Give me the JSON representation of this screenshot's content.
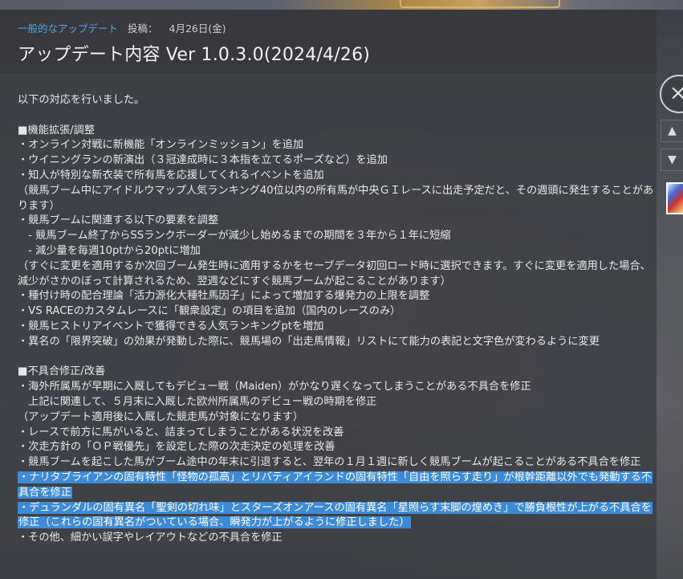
{
  "header": {
    "category": "一般的なアップデート",
    "posted_label": "投稿：",
    "date": "4月26日(金)",
    "title": "アップデート内容 Ver 1.0.3.0(2024/4/26)"
  },
  "body": {
    "intro": "以下の対応を行いました。",
    "section1": {
      "heading": "■機能拡張/調整",
      "lines": [
        "・オンライン対戦に新機能「オンラインミッション」を追加",
        "・ウイニングランの新演出（３冠達成時に３本指を立てるポーズなど）を追加",
        "・知人が特別な新衣装で所有馬を応援してくれるイベントを追加",
        "（競馬ブーム中にアイドルウマップ人気ランキング40位以内の所有馬が中央ＧＩレースに出走予定だと、その週頭に発生することがあります）",
        "・競馬ブームに関連する以下の要素を調整",
        "　- 競馬ブーム終了からSSランクボーダーが減少し始めるまでの期間を３年から１年に短縮",
        "　- 減少量を毎週10ptから20ptに増加",
        "（すぐに変更を適用するか次回ブーム発生時に適用するかをセーブデータ初回ロード時に選択できます。すぐに変更を適用した場合、減少がさかのぼって計算されるため、翌週などにすぐ競馬ブームが起こることがあります）",
        "・種付け時の配合理論「活力源化大種牡馬因子」によって増加する爆発力の上限を調整",
        "・VS RACEのカスタムレースに「観衆設定」の項目を追加（国内のレースのみ）",
        "・競馬ヒストリアイベントで獲得できる人気ランキングptを増加",
        "・異名の「限界突破」の効果が発動した際に、競馬場の「出走馬情報」リストにて能力の表記と文字色が変わるように変更"
      ]
    },
    "section2": {
      "heading": "■不具合修正/改善",
      "lines": [
        "・海外所属馬が早期に入厩してもデビュー戦（Maiden）がかなり遅くなってしまうことがある不具合を修正",
        "　上記に関連して、５月末に入厩した欧州所属馬のデビュー戦の時期を修正",
        "（アップデート適用後に入厩した競走馬が対象になります）",
        "・レースで前方に馬がいると、詰まってしまうことがある状況を改善",
        "・次走方針の「ＯＰ戦優先」を設定した際の次走決定の処理を改善",
        "・競馬ブームを起こした馬がブーム途中の年末に引退すると、翌年の１月１週に新しく競馬ブームが起こることがある不具合を修正"
      ],
      "highlighted": [
        "・ナリタブライアンの固有特性「怪物の孤高」とリバティアイランドの固有特性「自由を照らす走り」が根幹距離以外でも発動する不具合を修正",
        "・デュランダルの固有異名「聖剣の切れ味」とスターズオンアースの固有異名「星照らす末脚の煌めき」で勝負根性が上がる不具合を修正（これらの固有異名がついている場合、瞬発力が上がるように修正しました）"
      ],
      "last": "・その他、細かい誤字やレイアウトなどの不具合を修正"
    }
  },
  "side": {
    "close_icon": "×",
    "up_icon": "▲",
    "down_icon": "▼"
  }
}
